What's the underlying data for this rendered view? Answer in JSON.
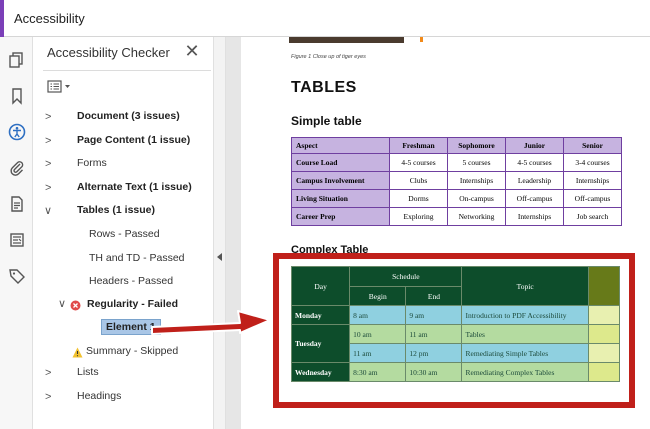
{
  "app": {
    "title": "Accessibility"
  },
  "toolbar": {
    "tools": [
      {
        "icon": "pages-icon"
      },
      {
        "icon": "bookmark-icon"
      },
      {
        "icon": "accessibility-icon",
        "active": true
      },
      {
        "icon": "paperclip-icon"
      },
      {
        "icon": "document-icon"
      },
      {
        "icon": "content-icon"
      },
      {
        "icon": "tag-icon"
      }
    ]
  },
  "panel": {
    "title": "Accessibility Checker",
    "close_label": "✕",
    "options_icon": "options-menu-icon",
    "tree": [
      {
        "label": "Document (3 issues)",
        "bold": true
      },
      {
        "label": "Page Content (1 issue)",
        "bold": true
      },
      {
        "label": "Forms",
        "bold": false
      },
      {
        "label": "Alternate Text (1 issue)",
        "bold": true
      },
      {
        "label": "Tables (1 issue)",
        "bold": true
      },
      {
        "label": "Rows - Passed"
      },
      {
        "label": "TH and TD - Passed"
      },
      {
        "label": "Headers - Passed"
      },
      {
        "label": "Regularity - Failed",
        "bold": true
      },
      {
        "label": "Element 1",
        "bold": true,
        "selected": true
      },
      {
        "label": "Summary - Skipped"
      },
      {
        "label": "Lists"
      },
      {
        "label": "Headings"
      }
    ]
  },
  "document": {
    "caption": "Figure 1 Close up of tiger eyes",
    "heading": "TABLES",
    "simple_table_heading": "Simple table",
    "complex_table_heading": "Complex Table",
    "simple_table": {
      "headers": [
        "Aspect",
        "Freshman",
        "Sophomore",
        "Junior",
        "Senior"
      ],
      "rows": [
        [
          "Course Load",
          "4-5 courses",
          "5 courses",
          "4-5 courses",
          "3-4 courses"
        ],
        [
          "Campus Involvement",
          "Clubs",
          "Internships",
          "Leadership",
          "Internships"
        ],
        [
          "Living Situation",
          "Dorms",
          "On-campus",
          "Off-campus",
          "Off-campus"
        ],
        [
          "Career Prep",
          "Exploring",
          "Networking",
          "Internships",
          "Job search"
        ]
      ]
    },
    "complex_table": {
      "day_header": "Day",
      "schedule_header": "Schedule",
      "begin_header": "Begin",
      "end_header": "End",
      "topic_header": "Topic",
      "rows": [
        {
          "day": "Monday",
          "begin": "8 am",
          "end": "9 am",
          "topic": "Introduction to PDF Accessibility"
        },
        {
          "day": "Tuesday",
          "begin": "10 am",
          "end": "11 am",
          "topic": "Tables"
        },
        {
          "day": "",
          "begin": "11 am",
          "end": "12 pm",
          "topic": "Remediating Simple Tables"
        },
        {
          "day": "Wednesday",
          "begin": "8:30 am",
          "end": "10:30 am",
          "topic": "Remediating Complex Tables"
        }
      ]
    }
  },
  "colors": {
    "accent": "#7b3fb8",
    "callout": "#c0201a",
    "error": "#e04a4a",
    "warning": "#f2c12e"
  }
}
